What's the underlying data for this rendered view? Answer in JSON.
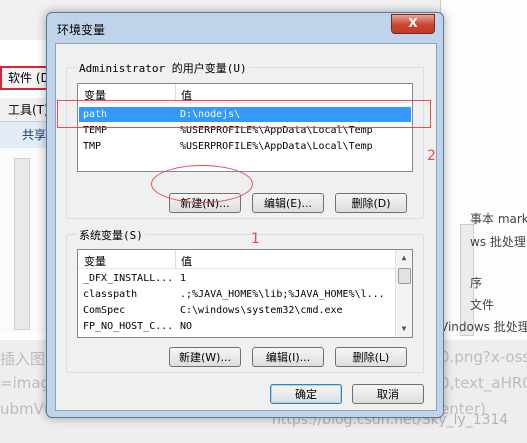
{
  "background": {
    "menu_label": "软件 (D",
    "tool_label": "工具(T)",
    "share_label": "共享",
    "right_texts": [
      "事本 mark",
      "ws 批处理",
      "序",
      "文件",
      "Vindows 批处理"
    ],
    "bottom_lines": [
      "插入图",
      "=image",
      "ubmV0"
    ],
    "bottom_url_lines": [
      "0.png?x-oss-",
      "0,text_aHR0",
      "enter)"
    ],
    "watermark": "https://blog.csdn.net/Sky_ly_1314"
  },
  "dialog": {
    "title": "环境变量",
    "close_label": "X",
    "user_group": {
      "label": "Administrator 的用户变量(U)",
      "columns": [
        "变量",
        "值"
      ],
      "rows": [
        {
          "name": "path",
          "value": "D:\\nodejs\\",
          "selected": true
        },
        {
          "name": "TEMP",
          "value": "%USERPROFILE%\\AppData\\Local\\Temp",
          "selected": false
        },
        {
          "name": "TMP",
          "value": "%USERPROFILE%\\AppData\\Local\\Temp",
          "selected": false
        }
      ],
      "buttons": {
        "new": "新建(N)...",
        "edit": "编辑(E)...",
        "delete": "删除(D)"
      }
    },
    "system_group": {
      "label": "系统变量(S)",
      "columns": [
        "变量",
        "值"
      ],
      "rows": [
        {
          "name": "_DFX_INSTALL...",
          "value": "1"
        },
        {
          "name": "classpath",
          "value": ".;%JAVA_HOME%\\lib;%JAVA_HOME%\\l..."
        },
        {
          "name": "ComSpec",
          "value": "C:\\windows\\system32\\cmd.exe"
        },
        {
          "name": "FP_NO_HOST_C...",
          "value": "NO"
        }
      ],
      "buttons": {
        "new": "新建(W)...",
        "edit": "编辑(I)...",
        "delete": "删除(L)"
      }
    },
    "ok_label": "确定",
    "cancel_label": "取消"
  },
  "annotations": {
    "label_1": "1",
    "label_2": "2"
  },
  "colors": {
    "selection": "#3399ff",
    "annotation": "#e05050"
  }
}
